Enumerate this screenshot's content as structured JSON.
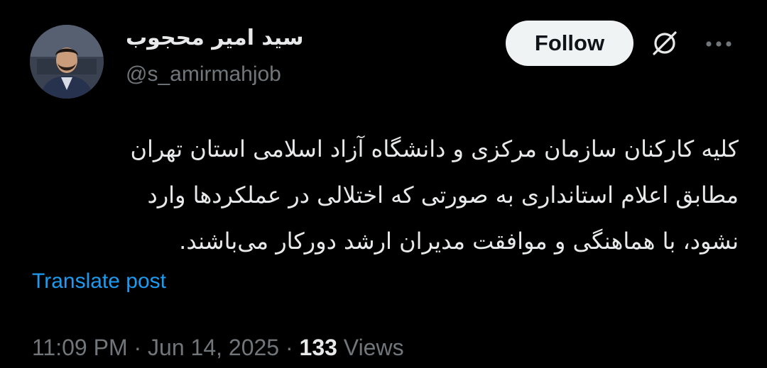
{
  "author": {
    "display_name": "سید امیر محجوب",
    "handle": "@s_amirmahjob"
  },
  "actions": {
    "follow_label": "Follow",
    "grok_icon": "grok-slash-icon",
    "more_icon": "more-dots-icon"
  },
  "tweet": {
    "lines": [
      "کلیه کارکنان سازمان مرکزی و دانشگاه آزاد اسلامی استان تهران",
      "مطابق اعلام استانداری به صورتی که اختلالی در عملکردها وارد",
      "نشود، با هماهنگی و موافقت مدیران ارشد دورکار می‌باشند."
    ],
    "translate_label": "Translate post"
  },
  "meta": {
    "time": "11:09 PM",
    "separator": "·",
    "date": "Jun 14, 2025",
    "views_count": "133",
    "views_label": "Views"
  },
  "colors": {
    "background": "#000000",
    "text": "#e7e9ea",
    "muted": "#71767b",
    "link": "#1d9bf0",
    "follow_bg": "#eff3f4"
  }
}
